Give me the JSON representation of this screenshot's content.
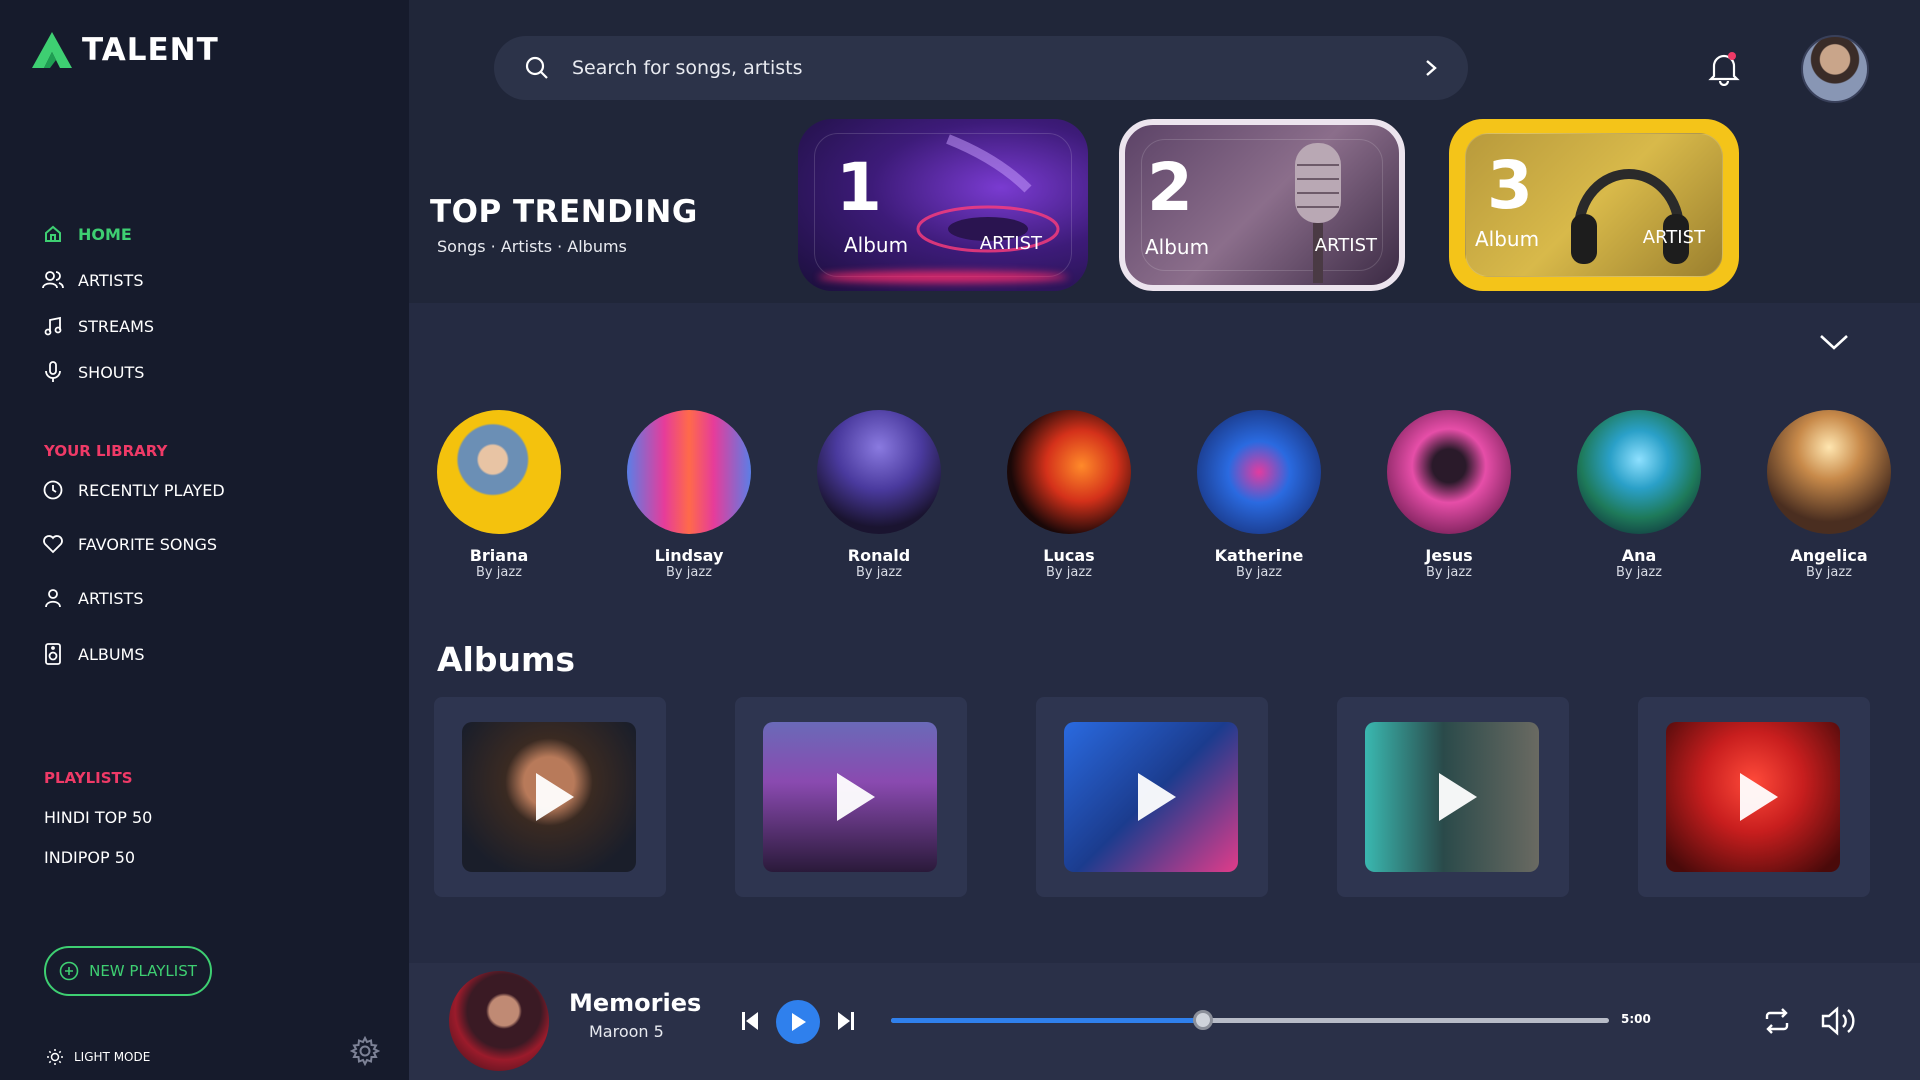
{
  "app": {
    "name": "TALENT"
  },
  "colors": {
    "accent_green": "#3ecf72",
    "accent_red": "#ef3a67",
    "accent_blue": "#2f80ed",
    "background": "#202639",
    "sidebar": "#161b2c"
  },
  "sidebar": {
    "nav": [
      {
        "label": "HOME",
        "icon": "home-icon",
        "active": true
      },
      {
        "label": "ARTISTS",
        "icon": "users-icon"
      },
      {
        "label": "STREAMS",
        "icon": "music-note-icon"
      },
      {
        "label": "SHOUTS",
        "icon": "microphone-icon"
      }
    ],
    "library_title": "YOUR LIBRARY",
    "library": [
      {
        "label": "RECENTLY PLAYED",
        "icon": "clock-icon"
      },
      {
        "label": "FAVORITE SONGS",
        "icon": "heart-icon"
      },
      {
        "label": "ARTISTS",
        "icon": "user-icon"
      },
      {
        "label": "ALBUMS",
        "icon": "speaker-icon"
      }
    ],
    "playlists_title": "PLAYLISTS",
    "playlists": [
      "HINDI TOP 50",
      "INDIPOP 50"
    ],
    "new_playlist_label": "NEW PLAYLIST",
    "light_mode_label": "LIGHT MODE"
  },
  "search": {
    "placeholder": "Search for songs, artists"
  },
  "trending": {
    "title": "TOP TRENDING",
    "subtitle": "Songs · Artists · Albums",
    "cards": [
      {
        "number": "1",
        "album_label": "Album",
        "artist_label": "ARTIST"
      },
      {
        "number": "2",
        "album_label": "Album",
        "artist_label": "ARTIST"
      },
      {
        "number": "3",
        "album_label": "Album",
        "artist_label": "ARTIST"
      }
    ]
  },
  "artists": [
    {
      "name": "Briana",
      "by": "By jazz"
    },
    {
      "name": "Lindsay",
      "by": "By jazz"
    },
    {
      "name": "Ronald",
      "by": "By jazz"
    },
    {
      "name": "Lucas",
      "by": "By jazz"
    },
    {
      "name": "Katherine",
      "by": "By jazz"
    },
    {
      "name": "Jesus",
      "by": "By jazz"
    },
    {
      "name": "Ana",
      "by": "By jazz"
    },
    {
      "name": "Angelica",
      "by": "By jazz"
    }
  ],
  "albums": {
    "title": "Albums",
    "count": 5
  },
  "player": {
    "title": "Memories",
    "artist": "Maroon 5",
    "duration": "5:00",
    "progress": 0.435
  }
}
